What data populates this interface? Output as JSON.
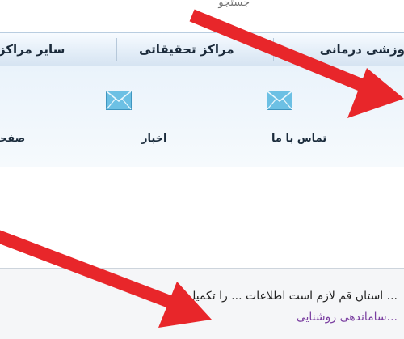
{
  "search": {
    "placeholder": "جستجو"
  },
  "nav": {
    "medical_centers": "...وزشی درمانی",
    "research_centers": "مراکز تحقیقاتی",
    "other_centers": "سایر مراکز"
  },
  "quick_links": {
    "contact_us": "تماس با ما",
    "news": "اخبار",
    "page": "صفحه"
  },
  "notice": {
    "text": "... استان قم لازم است اطلاعات ... را تکمیل کنند",
    "link": "...ساماندهی روشنایی"
  },
  "colors": {
    "arrow": "#e8262a",
    "mail_icon": "#5fb3d8",
    "link": "#7a3ea0"
  }
}
